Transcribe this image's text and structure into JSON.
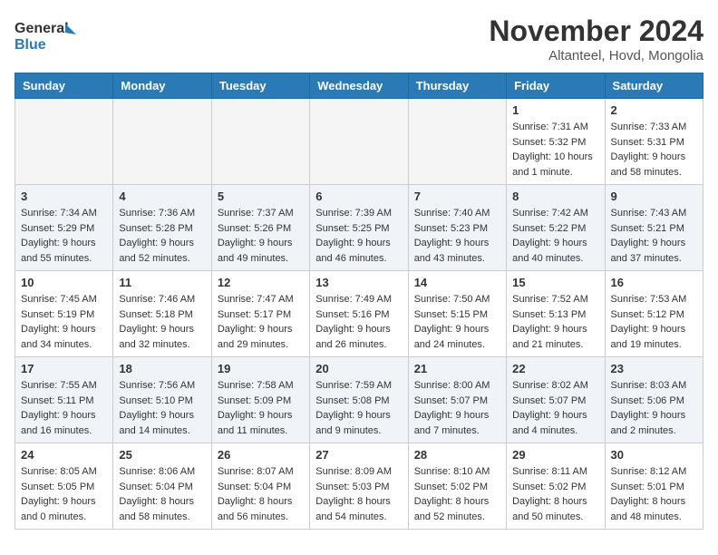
{
  "header": {
    "logo_line1": "General",
    "logo_line2": "Blue",
    "month": "November 2024",
    "location": "Altanteel, Hovd, Mongolia"
  },
  "days_of_week": [
    "Sunday",
    "Monday",
    "Tuesday",
    "Wednesday",
    "Thursday",
    "Friday",
    "Saturday"
  ],
  "weeks": [
    [
      {
        "day": "",
        "info": ""
      },
      {
        "day": "",
        "info": ""
      },
      {
        "day": "",
        "info": ""
      },
      {
        "day": "",
        "info": ""
      },
      {
        "day": "",
        "info": ""
      },
      {
        "day": "1",
        "info": "Sunrise: 7:31 AM\nSunset: 5:32 PM\nDaylight: 10 hours and 1 minute."
      },
      {
        "day": "2",
        "info": "Sunrise: 7:33 AM\nSunset: 5:31 PM\nDaylight: 9 hours and 58 minutes."
      }
    ],
    [
      {
        "day": "3",
        "info": "Sunrise: 7:34 AM\nSunset: 5:29 PM\nDaylight: 9 hours and 55 minutes."
      },
      {
        "day": "4",
        "info": "Sunrise: 7:36 AM\nSunset: 5:28 PM\nDaylight: 9 hours and 52 minutes."
      },
      {
        "day": "5",
        "info": "Sunrise: 7:37 AM\nSunset: 5:26 PM\nDaylight: 9 hours and 49 minutes."
      },
      {
        "day": "6",
        "info": "Sunrise: 7:39 AM\nSunset: 5:25 PM\nDaylight: 9 hours and 46 minutes."
      },
      {
        "day": "7",
        "info": "Sunrise: 7:40 AM\nSunset: 5:23 PM\nDaylight: 9 hours and 43 minutes."
      },
      {
        "day": "8",
        "info": "Sunrise: 7:42 AM\nSunset: 5:22 PM\nDaylight: 9 hours and 40 minutes."
      },
      {
        "day": "9",
        "info": "Sunrise: 7:43 AM\nSunset: 5:21 PM\nDaylight: 9 hours and 37 minutes."
      }
    ],
    [
      {
        "day": "10",
        "info": "Sunrise: 7:45 AM\nSunset: 5:19 PM\nDaylight: 9 hours and 34 minutes."
      },
      {
        "day": "11",
        "info": "Sunrise: 7:46 AM\nSunset: 5:18 PM\nDaylight: 9 hours and 32 minutes."
      },
      {
        "day": "12",
        "info": "Sunrise: 7:47 AM\nSunset: 5:17 PM\nDaylight: 9 hours and 29 minutes."
      },
      {
        "day": "13",
        "info": "Sunrise: 7:49 AM\nSunset: 5:16 PM\nDaylight: 9 hours and 26 minutes."
      },
      {
        "day": "14",
        "info": "Sunrise: 7:50 AM\nSunset: 5:15 PM\nDaylight: 9 hours and 24 minutes."
      },
      {
        "day": "15",
        "info": "Sunrise: 7:52 AM\nSunset: 5:13 PM\nDaylight: 9 hours and 21 minutes."
      },
      {
        "day": "16",
        "info": "Sunrise: 7:53 AM\nSunset: 5:12 PM\nDaylight: 9 hours and 19 minutes."
      }
    ],
    [
      {
        "day": "17",
        "info": "Sunrise: 7:55 AM\nSunset: 5:11 PM\nDaylight: 9 hours and 16 minutes."
      },
      {
        "day": "18",
        "info": "Sunrise: 7:56 AM\nSunset: 5:10 PM\nDaylight: 9 hours and 14 minutes."
      },
      {
        "day": "19",
        "info": "Sunrise: 7:58 AM\nSunset: 5:09 PM\nDaylight: 9 hours and 11 minutes."
      },
      {
        "day": "20",
        "info": "Sunrise: 7:59 AM\nSunset: 5:08 PM\nDaylight: 9 hours and 9 minutes."
      },
      {
        "day": "21",
        "info": "Sunrise: 8:00 AM\nSunset: 5:07 PM\nDaylight: 9 hours and 7 minutes."
      },
      {
        "day": "22",
        "info": "Sunrise: 8:02 AM\nSunset: 5:07 PM\nDaylight: 9 hours and 4 minutes."
      },
      {
        "day": "23",
        "info": "Sunrise: 8:03 AM\nSunset: 5:06 PM\nDaylight: 9 hours and 2 minutes."
      }
    ],
    [
      {
        "day": "24",
        "info": "Sunrise: 8:05 AM\nSunset: 5:05 PM\nDaylight: 9 hours and 0 minutes."
      },
      {
        "day": "25",
        "info": "Sunrise: 8:06 AM\nSunset: 5:04 PM\nDaylight: 8 hours and 58 minutes."
      },
      {
        "day": "26",
        "info": "Sunrise: 8:07 AM\nSunset: 5:04 PM\nDaylight: 8 hours and 56 minutes."
      },
      {
        "day": "27",
        "info": "Sunrise: 8:09 AM\nSunset: 5:03 PM\nDaylight: 8 hours and 54 minutes."
      },
      {
        "day": "28",
        "info": "Sunrise: 8:10 AM\nSunset: 5:02 PM\nDaylight: 8 hours and 52 minutes."
      },
      {
        "day": "29",
        "info": "Sunrise: 8:11 AM\nSunset: 5:02 PM\nDaylight: 8 hours and 50 minutes."
      },
      {
        "day": "30",
        "info": "Sunrise: 8:12 AM\nSunset: 5:01 PM\nDaylight: 8 hours and 48 minutes."
      }
    ]
  ]
}
